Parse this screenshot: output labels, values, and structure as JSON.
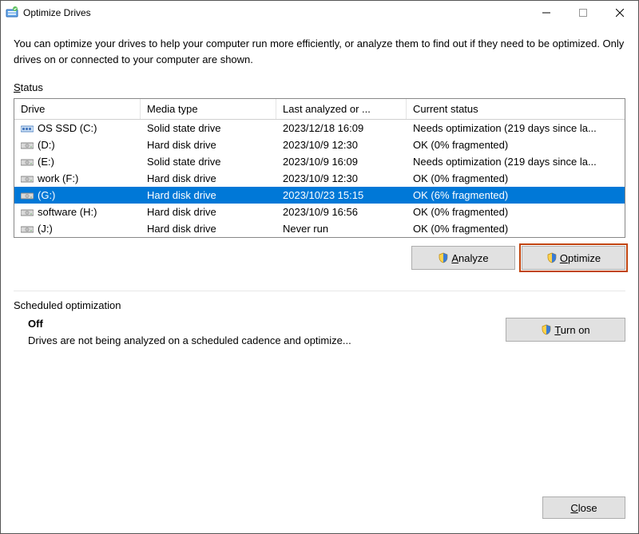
{
  "window": {
    "title": "Optimize Drives"
  },
  "intro": "You can optimize your drives to help your computer run more efficiently, or analyze them to find out if they need to be optimized. Only drives on or connected to your computer are shown.",
  "status_label_pre": "S",
  "status_label_post": "tatus",
  "columns": {
    "drive": "Drive",
    "media": "Media type",
    "last": "Last analyzed or ...",
    "status": "Current status"
  },
  "drives": [
    {
      "name": "OS SSD (C:)",
      "media": "Solid state drive",
      "last": "2023/12/18 16:09",
      "status": "Needs optimization (219 days since la...",
      "icon": "ssd"
    },
    {
      "name": "(D:)",
      "media": "Hard disk drive",
      "last": "2023/10/9 12:30",
      "status": "OK (0% fragmented)",
      "icon": "hdd"
    },
    {
      "name": "(E:)",
      "media": "Solid state drive",
      "last": "2023/10/9 16:09",
      "status": "Needs optimization (219 days since la...",
      "icon": "hdd"
    },
    {
      "name": "work (F:)",
      "media": "Hard disk drive",
      "last": "2023/10/9 12:30",
      "status": "OK (0% fragmented)",
      "icon": "hdd"
    },
    {
      "name": "(G:)",
      "media": "Hard disk drive",
      "last": "2023/10/23 15:15",
      "status": "OK (6% fragmented)",
      "icon": "hdd",
      "selected": true
    },
    {
      "name": "software (H:)",
      "media": "Hard disk drive",
      "last": "2023/10/9 16:56",
      "status": "OK (0% fragmented)",
      "icon": "hdd"
    },
    {
      "name": "(J:)",
      "media": "Hard disk drive",
      "last": "Never run",
      "status": "OK (0% fragmented)",
      "icon": "hdd"
    }
  ],
  "buttons": {
    "analyze_pre": "A",
    "analyze_post": "nalyze",
    "optimize_pre": "O",
    "optimize_post": "ptimize",
    "turn_on_pre": "T",
    "turn_on_post": "urn on",
    "close_pre": "C",
    "close_post": "lose"
  },
  "schedule": {
    "label": "Scheduled optimization",
    "state": "Off",
    "desc": "Drives are not being analyzed on a scheduled cadence and optimize..."
  }
}
